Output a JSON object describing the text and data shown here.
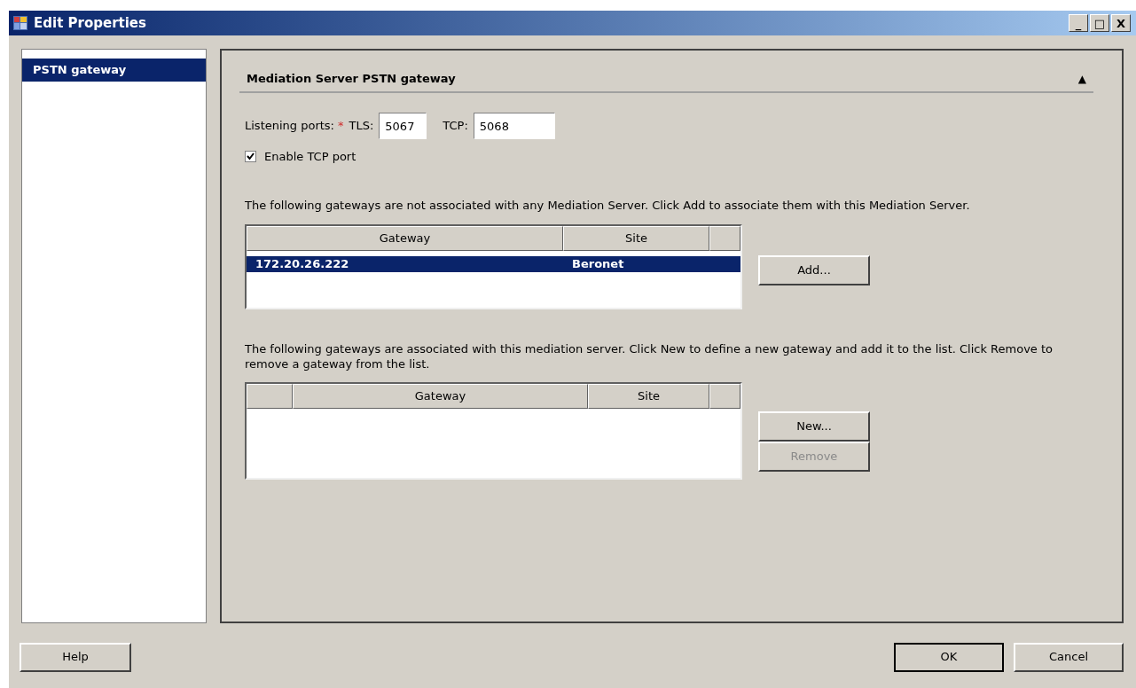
{
  "window": {
    "title": "Edit Properties",
    "controls": [
      "_",
      "□",
      "X"
    ]
  },
  "sidebar": {
    "items": [
      {
        "label": "PSTN gateway",
        "selected": true
      }
    ]
  },
  "section": {
    "title": "Mediation Server PSTN gateway",
    "expanded": true,
    "toggle": "▲"
  },
  "ports": {
    "label": "Listening ports:",
    "required": "*",
    "tls_label": "TLS:",
    "tls_value": "5067",
    "tcp_label": "TCP:",
    "tcp_value": "5068"
  },
  "enable_tcp": {
    "label": "Enable TCP port",
    "checked": true
  },
  "unassociated": {
    "description": "The following gateways are not associated with any Mediation Server.  Click Add to associate them with this Mediation Server.",
    "columns": [
      "Gateway",
      "Site"
    ],
    "rows": [
      {
        "gateway": "172.20.26.222",
        "site": "Beronet",
        "selected": true
      }
    ],
    "buttons": [
      {
        "label": "Add...",
        "disabled": false
      }
    ]
  },
  "associated": {
    "description": "The following gateways are associated with this mediation server.  Click New to define a new gateway and add it to the list.  Click Remove to remove a gateway from the list.",
    "columns": [
      "Gateway",
      "Site"
    ],
    "buttons": [
      {
        "label": "New...",
        "disabled": false
      },
      {
        "label": "Remove",
        "disabled": true
      }
    ]
  },
  "footer": {
    "help": "Help",
    "ok": "OK",
    "cancel": "Cancel"
  }
}
